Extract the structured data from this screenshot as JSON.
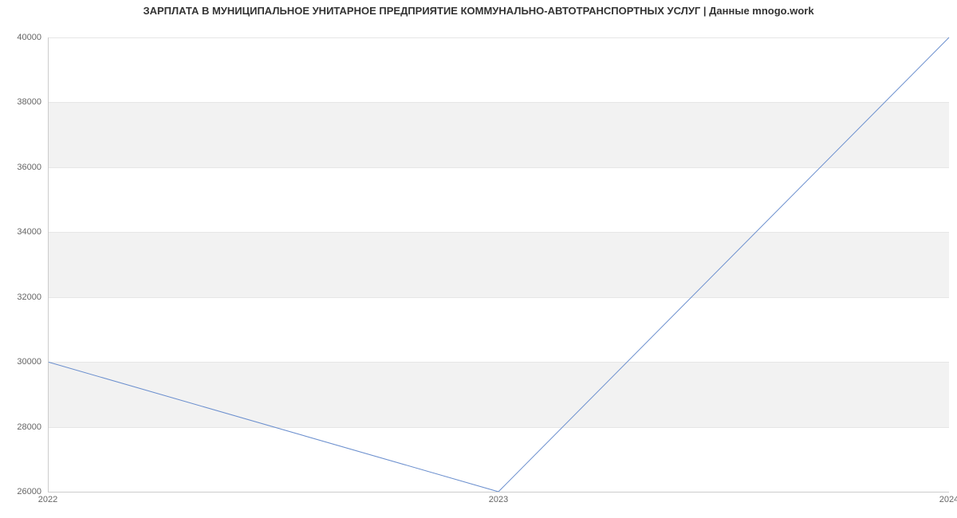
{
  "chart_data": {
    "type": "line",
    "title": "ЗАРПЛАТА В МУНИЦИПАЛЬНОЕ УНИТАРНОЕ ПРЕДПРИЯТИЕ КОММУНАЛЬНО-АВТОТРАНСПОРТНЫХ УСЛУГ | Данные mnogo.work",
    "x": [
      2022,
      2023,
      2024
    ],
    "values": [
      30000,
      26000,
      40000
    ],
    "x_ticks": [
      2022,
      2023,
      2024
    ],
    "y_ticks": [
      26000,
      28000,
      30000,
      32000,
      34000,
      36000,
      38000,
      40000
    ],
    "xlabel": "",
    "ylabel": "",
    "xlim": [
      2022,
      2024
    ],
    "ylim": [
      26000,
      40000
    ],
    "line_color": "#6b8fce",
    "grid": true
  }
}
